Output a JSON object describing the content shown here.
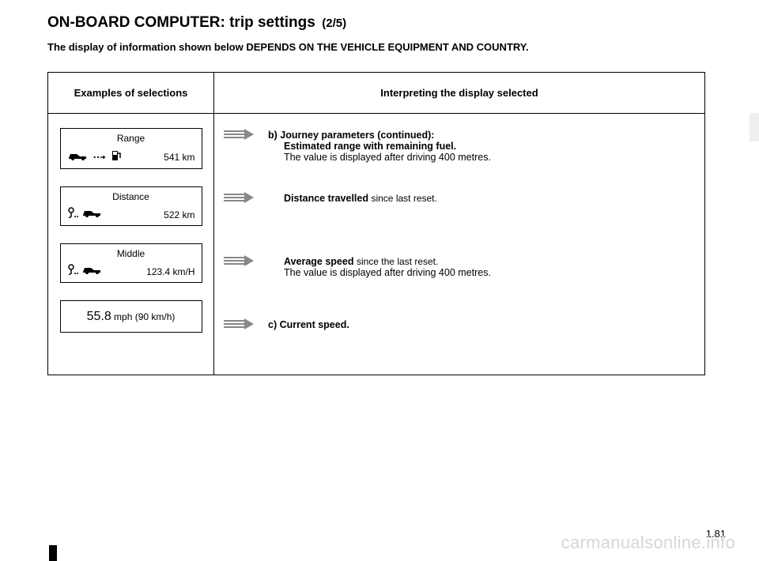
{
  "title": {
    "main": "ON-BOARD COMPUTER: trip settings",
    "sub": "(2/5)"
  },
  "subtitle": "The display of information shown below DEPENDS ON THE VEHICLE EQUIPMENT AND COUNTRY.",
  "table": {
    "header_left": "Examples of selections",
    "header_right": "Interpreting the display selected"
  },
  "rows": [
    {
      "display": {
        "label": "Range",
        "value": "541 km",
        "icons": "range"
      },
      "heading": "b) Journey parameters (continued):",
      "bold": "Estimated range with remaining fuel.",
      "rest": "",
      "line2": "The value is displayed after driving 400 metres.",
      "indent": true
    },
    {
      "display": {
        "label": "Distance",
        "value": "522 km",
        "icons": "distance"
      },
      "heading": "",
      "bold": "Distance travelled ",
      "rest": "since last reset.",
      "line2": "",
      "indent": true
    },
    {
      "display": {
        "label": "Middle",
        "value": "123.4 km/H",
        "icons": "distance"
      },
      "heading": "",
      "bold": "Average speed ",
      "rest": "since the last reset.",
      "line2": "The value is displayed after driving 400 metres.",
      "indent": true
    },
    {
      "display": {
        "label": "",
        "value_big": "55.8",
        "value_small": " mph (90 km/h)",
        "icons": "speed"
      },
      "heading": "",
      "bold": "c) Current speed.",
      "rest": "",
      "line2": "",
      "indent": false
    }
  ],
  "page_number": "1.81",
  "watermark": "carmanualsonline.info"
}
